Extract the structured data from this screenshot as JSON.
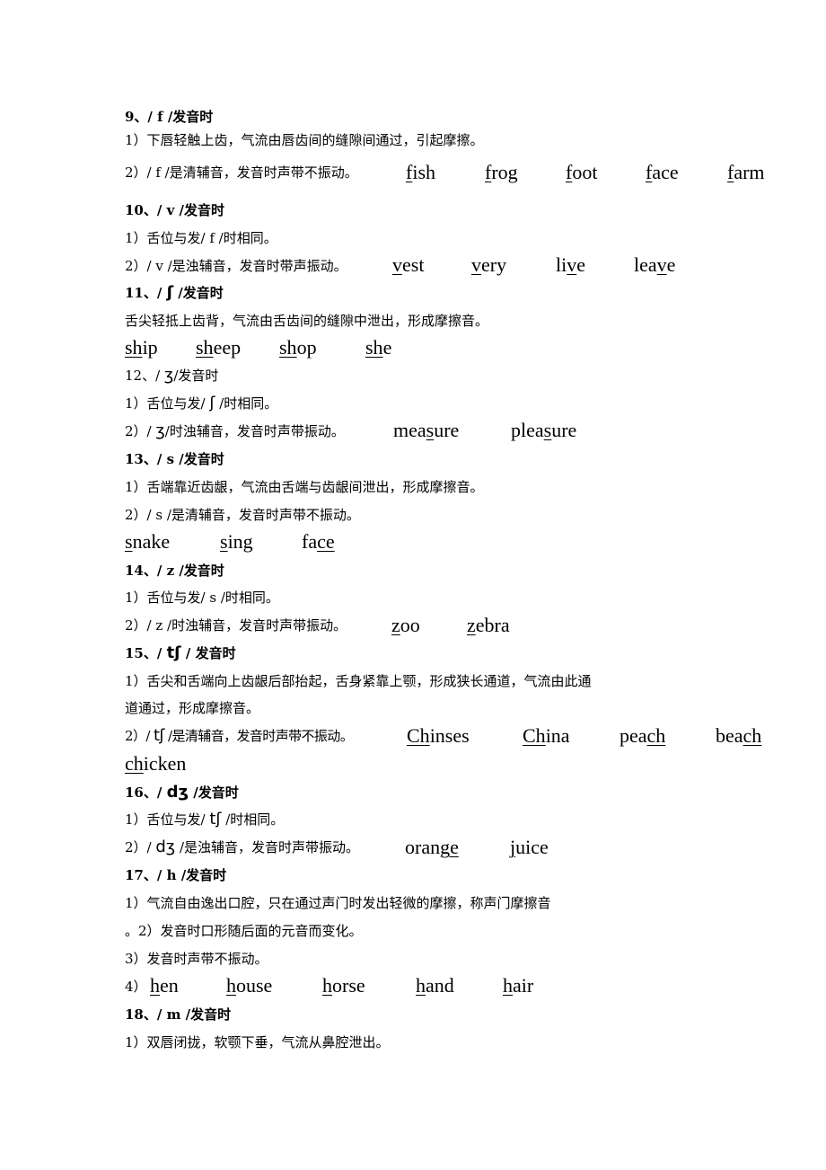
{
  "sections": [
    {
      "id": "9",
      "heading": "9、/ f /发音时",
      "lines": [
        "1）下唇轻触上齿，气流由唇齿间的缝隙间通过，引起摩擦。",
        "2）/ f /是清辅音，发音时声带不振动。"
      ],
      "words": [
        {
          "pre": "",
          "u": "f",
          "post": "ish"
        },
        {
          "pre": "",
          "u": "f",
          "post": "rog"
        },
        {
          "pre": "",
          "u": "f",
          "post": "oot"
        },
        {
          "pre": "",
          "u": "f",
          "post": "ace"
        },
        {
          "pre": "",
          "u": "f",
          "post": "arm"
        }
      ]
    },
    {
      "id": "10",
      "heading": "10、/ v /发音时",
      "lines": [
        "1）舌位与发/ f /时相同。",
        "2）/ v /是浊辅音，发音时带声振动。"
      ],
      "words": [
        {
          "pre": "",
          "u": "v",
          "post": "est"
        },
        {
          "pre": "",
          "u": "v",
          "post": "ery"
        },
        {
          "pre": "li",
          "u": "v",
          "post": "e"
        },
        {
          "pre": "lea",
          "u": "v",
          "post": "e"
        }
      ]
    },
    {
      "id": "11",
      "heading_pre": "11、/ ",
      "heading_ipa": "ʃ",
      "heading_post": " /发音时",
      "lines": [
        "舌尖轻抵上齿背，气流由舌齿间的缝隙中泄出，形成摩擦音。"
      ],
      "words": [
        {
          "pre": "",
          "u": "sh",
          "post": "ip"
        },
        {
          "pre": "",
          "u": "sh",
          "post": "eep"
        },
        {
          "pre": "",
          "u": "sh",
          "post": "op"
        },
        {
          "pre": "",
          "u": "sh",
          "post": "e"
        }
      ]
    },
    {
      "id": "12",
      "heading_pre": "12、/ ",
      "heading_ipa": "ʒ",
      "heading_post": "/发音时",
      "line1_pre": "1）舌位与发/ ",
      "line1_ipa": "ʃ",
      "line1_post": " /时相同。",
      "line2_pre": "2）/ ",
      "line2_ipa": "ʒ",
      "line2_post": "/时浊辅音，发音时声带振动。",
      "words": [
        {
          "pre": "mea",
          "u": "s",
          "post": "ure"
        },
        {
          "pre": "plea",
          "u": "s",
          "post": "ure"
        }
      ]
    },
    {
      "id": "13",
      "heading": "13、/ s /发音时",
      "lines": [
        "1）舌端靠近齿龈，气流由舌端与齿龈间泄出，形成摩擦音。",
        "2）/ s /是清辅音，发音时声带不振动。"
      ],
      "words": [
        {
          "pre": "",
          "u": "s",
          "post": "nake"
        },
        {
          "pre": "",
          "u": "s",
          "post": "ing"
        },
        {
          "pre": "fa",
          "u": "ce",
          "post": ""
        }
      ]
    },
    {
      "id": "14",
      "heading": "14、/ z /发音时",
      "lines": [
        "1）舌位与发/ s /时相同。",
        "2）/ z /时浊辅音，发音时声带振动。"
      ],
      "words": [
        {
          "pre": "",
          "u": "z",
          "post": "oo"
        },
        {
          "pre": "",
          "u": "z",
          "post": "ebra"
        }
      ]
    },
    {
      "id": "15",
      "heading_pre": "15、/ ",
      "heading_ipa": "tʃ",
      "heading_post": " /  发音时",
      "lines": [
        "1）舌尖和舌端向上齿龈后部抬起，舌身紧靠上颚，形成狭长通道，气流由此通",
        "道通过，形成摩擦音。"
      ],
      "line3_pre": "2）/ ",
      "line3_ipa": "tʃ",
      "line3_post": " /是清辅音，发音时声带不振动。",
      "words": [
        {
          "pre": "",
          "u": "Ch",
          "post": "inses"
        },
        {
          "pre": "",
          "u": "Ch",
          "post": "ina"
        },
        {
          "pre": "pea",
          "u": "ch",
          "post": ""
        },
        {
          "pre": "bea",
          "u": "ch",
          "post": ""
        },
        {
          "pre": "",
          "u": "ch",
          "post": "icken"
        }
      ]
    },
    {
      "id": "16",
      "heading_pre": "16、/ ",
      "heading_ipa": "dʒ",
      "heading_post": " /发音时",
      "line1_pre": "1）舌位与发/ ",
      "line1_ipa": "tʃ",
      "line1_post": " /时相同。",
      "line2_pre": "2）/ ",
      "line2_ipa": "dʒ",
      "line2_post": " /是浊辅音，发音时声带振动。",
      "words": [
        {
          "pre": "oran",
          "u": "ge",
          "post": ""
        },
        {
          "pre": "",
          "u": "j",
          "post": "uice"
        }
      ]
    },
    {
      "id": "17",
      "heading": "17、/ h /发音时",
      "lines": [
        "1）气流自由逸出口腔，只在通过声门时发出轻微的摩擦，称声门摩擦音",
        "。2）发音时口形随后面的元音而变化。",
        "3）发音时声带不振动。"
      ],
      "list_prefix": "4）",
      "words": [
        {
          "pre": "",
          "u": "h",
          "post": "en"
        },
        {
          "pre": "",
          "u": "h",
          "post": "ouse"
        },
        {
          "pre": "",
          "u": "h",
          "post": "orse"
        },
        {
          "pre": "",
          "u": "h",
          "post": "and"
        },
        {
          "pre": "",
          "u": "h",
          "post": "air"
        }
      ]
    },
    {
      "id": "18",
      "heading": "18、/ m /发音时",
      "lines": [
        "1）双唇闭拢，软颚下垂，气流从鼻腔泄出。"
      ]
    }
  ]
}
